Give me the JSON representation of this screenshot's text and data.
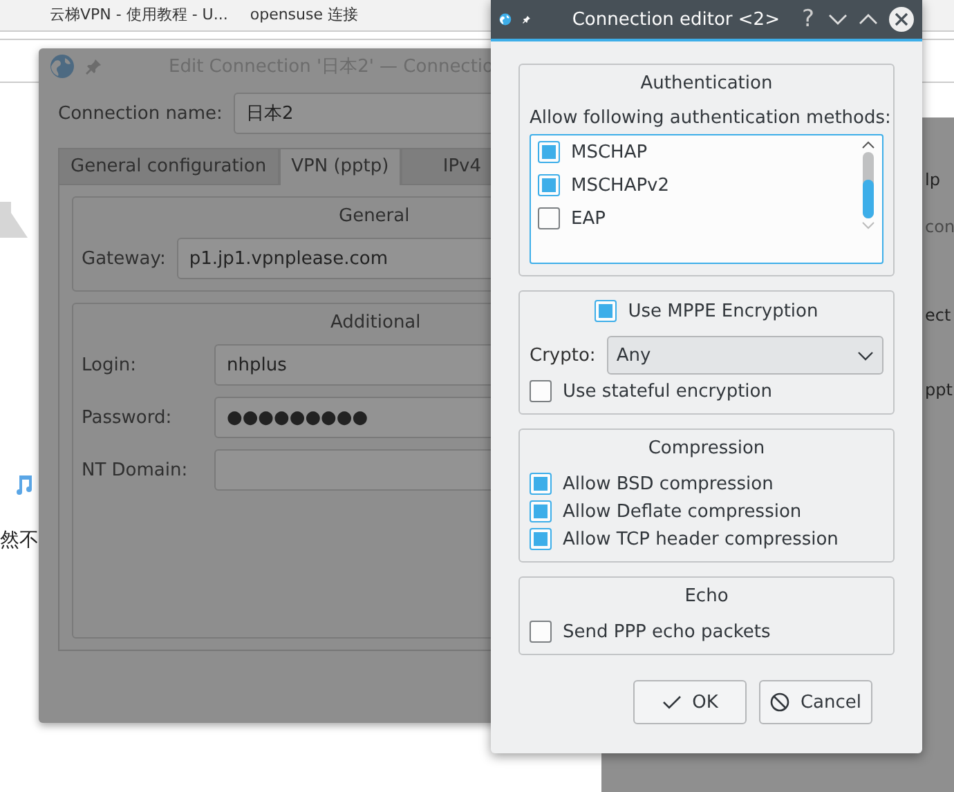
{
  "browser": {
    "tabs": [
      {
        "label": "云梯VPN - 使用教程 - U..."
      },
      {
        "label": "opensuse 连接"
      }
    ],
    "page_text": "然不"
  },
  "back_window": {
    "fragments": [
      "lp",
      "con",
      "ect",
      "ppt"
    ]
  },
  "edit_window": {
    "title": "Edit Connection '日本2' — Connectio",
    "connection_name_label": "Connection name:",
    "connection_name": "日本2",
    "tabs": [
      {
        "label": "General configuration",
        "selected": false
      },
      {
        "label": "VPN (pptp)",
        "selected": true
      },
      {
        "label": "IPv4",
        "selected": false
      }
    ],
    "general": {
      "title": "General",
      "gateway_label": "Gateway:",
      "gateway": "p1.jp1.vpnplease.com"
    },
    "additional": {
      "title": "Additional",
      "fields": [
        {
          "label": "Login:",
          "value": "nhplus"
        },
        {
          "label": "Password:",
          "value": "●●●●●●●●●"
        },
        {
          "label": "NT Domain:"
        }
      ]
    }
  },
  "dialog": {
    "title": "Connection editor <2>",
    "help": "?",
    "authentication": {
      "title": "Authentication",
      "list_label": "Allow following authentication methods:",
      "methods": [
        {
          "label": "MSCHAP",
          "checked": true
        },
        {
          "label": "MSCHAPv2",
          "checked": true
        },
        {
          "label": "EAP",
          "checked": false
        }
      ]
    },
    "encryption": {
      "use_mppe": {
        "label": "Use MPPE Encryption",
        "checked": true
      },
      "crypto_label": "Crypto:",
      "crypto": "Any",
      "stateful": {
        "label": "Use stateful encryption",
        "checked": false
      }
    },
    "compression": {
      "title": "Compression",
      "options": [
        {
          "label": "Allow BSD compression",
          "checked": true
        },
        {
          "label": "Allow Deflate compression",
          "checked": true
        },
        {
          "label": "Allow TCP header compression",
          "checked": true
        }
      ]
    },
    "echo": {
      "title": "Echo",
      "options": [
        {
          "label": "Send PPP echo packets",
          "checked": false
        }
      ]
    },
    "buttons": [
      {
        "label": "OK",
        "kind": "ok"
      },
      {
        "label": "Cancel",
        "kind": "cancel"
      }
    ]
  }
}
